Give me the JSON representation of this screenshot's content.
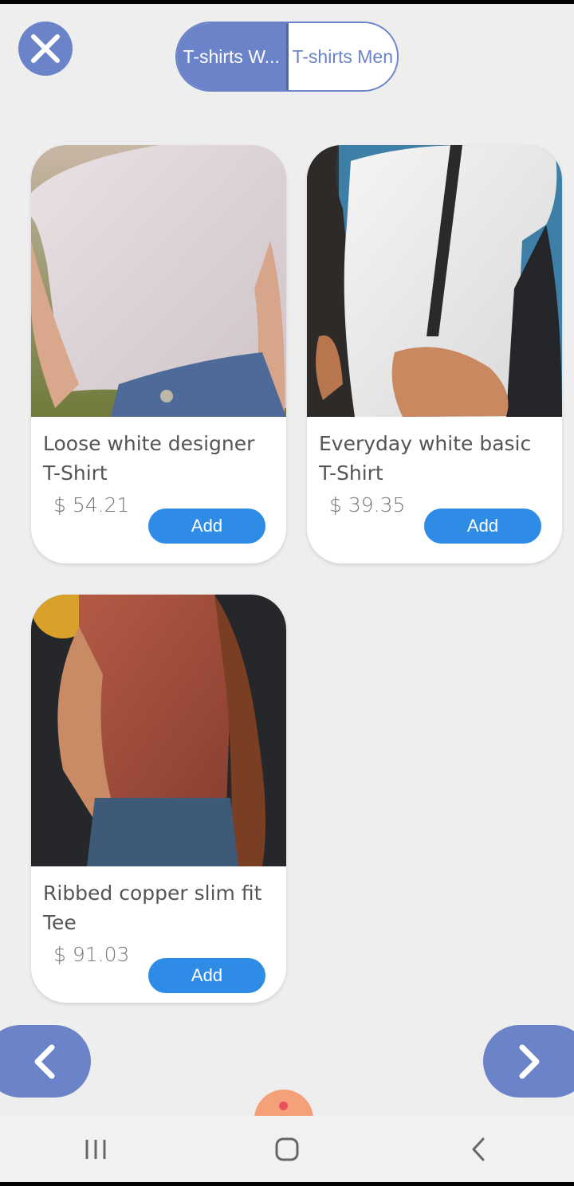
{
  "segments": [
    {
      "label": "T-shirts W...",
      "active": true
    },
    {
      "label": "T-shirts Men",
      "active": false
    }
  ],
  "products": [
    {
      "name": "Loose white designer T-Shirt",
      "price": "$ 54.21",
      "add_label": "Add"
    },
    {
      "name": "Everyday white basic T-Shirt",
      "price": "$ 39.35",
      "add_label": "Add"
    },
    {
      "name": "Ribbed copper slim fit Tee",
      "price": "$ 91.03",
      "add_label": "Add"
    }
  ],
  "icons": {
    "close": "close-icon",
    "prev": "chevron-left-icon",
    "next": "chevron-right-icon",
    "recents": "recents-icon",
    "home": "home-icon",
    "back": "back-icon"
  },
  "colors": {
    "accent": "#6b83c8",
    "add_button": "#2e8be6",
    "background": "#eeeeee"
  }
}
